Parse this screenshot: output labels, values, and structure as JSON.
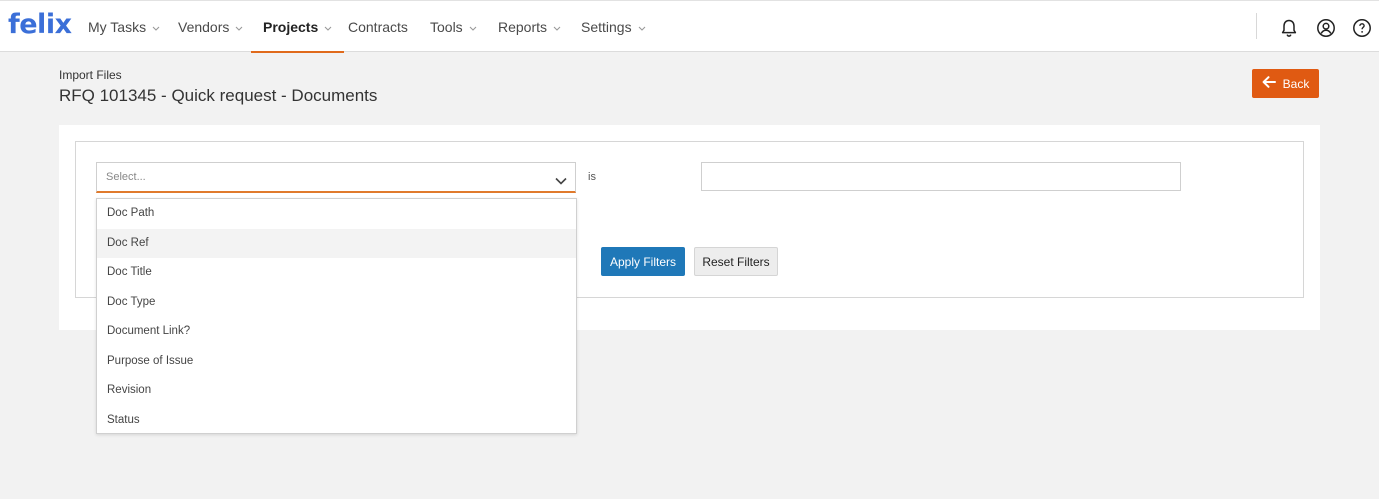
{
  "app": {
    "logo": "felix"
  },
  "nav": {
    "items": [
      {
        "label": "My Tasks",
        "dropdown": true,
        "active": false
      },
      {
        "label": "Vendors",
        "dropdown": true,
        "active": false
      },
      {
        "label": "Projects",
        "dropdown": true,
        "active": true
      },
      {
        "label": "Contracts",
        "dropdown": false,
        "active": false
      },
      {
        "label": "Tools",
        "dropdown": true,
        "active": false
      },
      {
        "label": "Reports",
        "dropdown": true,
        "active": false
      },
      {
        "label": "Settings",
        "dropdown": true,
        "active": false
      }
    ],
    "icons": [
      "bell-icon",
      "user-circle-icon",
      "help-icon"
    ]
  },
  "header": {
    "breadcrumb": "Import Files",
    "title": "RFQ 101345 - Quick request - Documents",
    "back_label": "Back"
  },
  "filter": {
    "field_placeholder": "Select...",
    "operator": "is",
    "value": "",
    "apply_label": "Apply Filters",
    "reset_label": "Reset Filters",
    "options": [
      "Doc Path",
      "Doc Ref",
      "Doc Title",
      "Doc Type",
      "Document Link?",
      "Purpose of Issue",
      "Revision",
      "Status"
    ],
    "hovered_option": "Doc Ref"
  },
  "colors": {
    "brand_blue": "#3b6fd8",
    "accent_orange": "#e06a1c",
    "back_button": "#e05a12",
    "apply_button": "#1f78b8"
  }
}
